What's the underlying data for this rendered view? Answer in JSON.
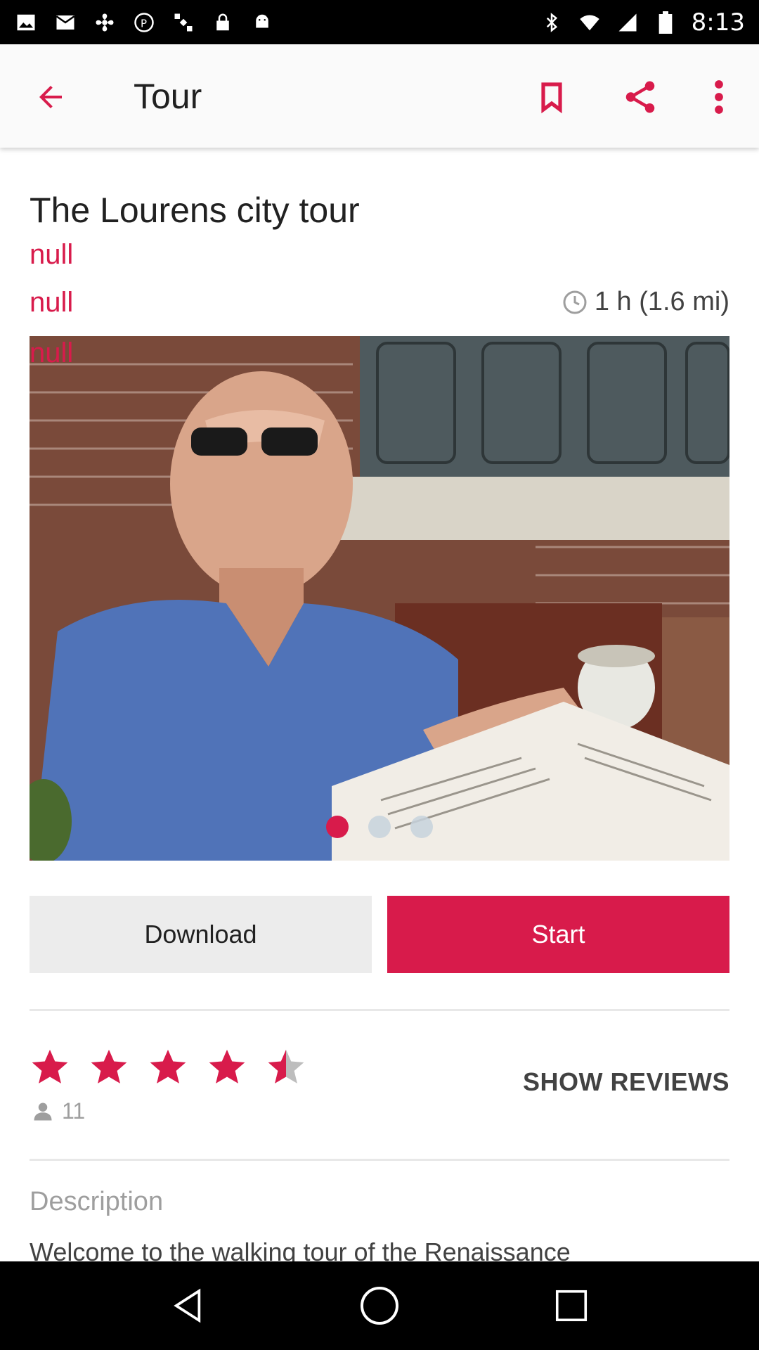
{
  "status_bar": {
    "time": "8:13",
    "left_icons": [
      "image-icon",
      "mail-icon",
      "fan-icon",
      "p-icon",
      "satellite-icon",
      "lock-icon",
      "android-icon"
    ],
    "right_icons": [
      "bluetooth-icon",
      "wifi-icon",
      "signal-icon",
      "battery-icon"
    ]
  },
  "app_bar": {
    "title": "Tour",
    "icons": [
      "back-arrow-icon",
      "bookmark-icon",
      "share-icon",
      "more-vert-icon"
    ]
  },
  "tour": {
    "title": "The Lourens city tour",
    "subtitle_1": "null",
    "subtitle_2": "null",
    "duration": "1 h (1.6 mi)",
    "image_overlay": "null",
    "image_page_count": 3,
    "image_page_active": 1
  },
  "actions": {
    "download_label": "Download",
    "start_label": "Start"
  },
  "rating": {
    "value": 4.5,
    "max": 5,
    "count": "11",
    "show_reviews_label": "SHOW REVIEWS"
  },
  "description": {
    "heading": "Description",
    "text": "Welcome to the walking tour of the Renaissance"
  },
  "colors": {
    "accent": "#d81b4b",
    "app_bar_bg": "#fafafa",
    "secondary_button": "#ececec",
    "muted_text": "#9e9e9e"
  }
}
